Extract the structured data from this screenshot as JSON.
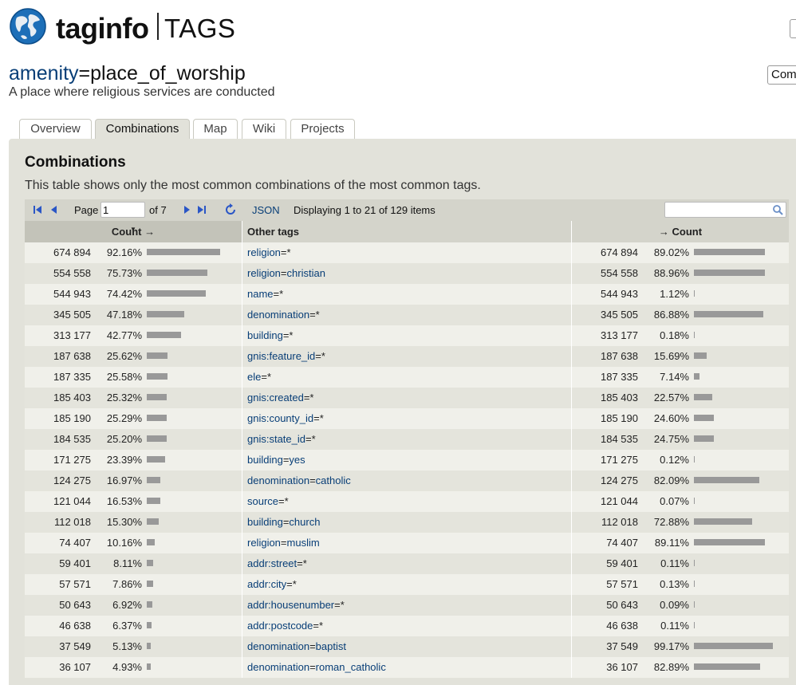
{
  "header": {
    "brand": "taginfo",
    "section": "TAGS",
    "language_label": "Com"
  },
  "tag": {
    "key": "amenity",
    "eq": "=",
    "value": "place_of_worship",
    "description": "A place where religious services are conducted"
  },
  "tabs": [
    {
      "label": "Overview",
      "active": false
    },
    {
      "label": "Combinations",
      "active": true
    },
    {
      "label": "Map",
      "active": false
    },
    {
      "label": "Wiki",
      "active": false
    },
    {
      "label": "Projects",
      "active": false
    }
  ],
  "panel": {
    "title": "Combinations",
    "text": "This table shows only the most common combinations of the most common tags."
  },
  "pager": {
    "page_label": "Page",
    "page_value": "1",
    "of_label": "of 7",
    "json_label": "JSON",
    "display_text": "Displaying 1 to 21 of 129 items",
    "search_placeholder": ""
  },
  "columns": {
    "count_left": "Count →",
    "other_tags": "Other tags",
    "count_right": "→ Count"
  },
  "rows": [
    {
      "count": "674 894",
      "pct": "92.16%",
      "key": "religion",
      "value": "*",
      "count2": "674 894",
      "pct2": "89.02%"
    },
    {
      "count": "554 558",
      "pct": "75.73%",
      "key": "religion",
      "value": "christian",
      "count2": "554 558",
      "pct2": "88.96%"
    },
    {
      "count": "544 943",
      "pct": "74.42%",
      "key": "name",
      "value": "*",
      "count2": "544 943",
      "pct2": "1.12%"
    },
    {
      "count": "345 505",
      "pct": "47.18%",
      "key": "denomination",
      "value": "*",
      "count2": "345 505",
      "pct2": "86.88%"
    },
    {
      "count": "313 177",
      "pct": "42.77%",
      "key": "building",
      "value": "*",
      "count2": "313 177",
      "pct2": "0.18%"
    },
    {
      "count": "187 638",
      "pct": "25.62%",
      "key": "gnis:feature_id",
      "value": "*",
      "count2": "187 638",
      "pct2": "15.69%"
    },
    {
      "count": "187 335",
      "pct": "25.58%",
      "key": "ele",
      "value": "*",
      "count2": "187 335",
      "pct2": "7.14%"
    },
    {
      "count": "185 403",
      "pct": "25.32%",
      "key": "gnis:created",
      "value": "*",
      "count2": "185 403",
      "pct2": "22.57%"
    },
    {
      "count": "185 190",
      "pct": "25.29%",
      "key": "gnis:county_id",
      "value": "*",
      "count2": "185 190",
      "pct2": "24.60%"
    },
    {
      "count": "184 535",
      "pct": "25.20%",
      "key": "gnis:state_id",
      "value": "*",
      "count2": "184 535",
      "pct2": "24.75%"
    },
    {
      "count": "171 275",
      "pct": "23.39%",
      "key": "building",
      "value": "yes",
      "count2": "171 275",
      "pct2": "0.12%"
    },
    {
      "count": "124 275",
      "pct": "16.97%",
      "key": "denomination",
      "value": "catholic",
      "count2": "124 275",
      "pct2": "82.09%"
    },
    {
      "count": "121 044",
      "pct": "16.53%",
      "key": "source",
      "value": "*",
      "count2": "121 044",
      "pct2": "0.07%"
    },
    {
      "count": "112 018",
      "pct": "15.30%",
      "key": "building",
      "value": "church",
      "count2": "112 018",
      "pct2": "72.88%"
    },
    {
      "count": "74 407",
      "pct": "10.16%",
      "key": "religion",
      "value": "muslim",
      "count2": "74 407",
      "pct2": "89.11%"
    },
    {
      "count": "59 401",
      "pct": "8.11%",
      "key": "addr:street",
      "value": "*",
      "count2": "59 401",
      "pct2": "0.11%"
    },
    {
      "count": "57 571",
      "pct": "7.86%",
      "key": "addr:city",
      "value": "*",
      "count2": "57 571",
      "pct2": "0.13%"
    },
    {
      "count": "50 643",
      "pct": "6.92%",
      "key": "addr:housenumber",
      "value": "*",
      "count2": "50 643",
      "pct2": "0.09%"
    },
    {
      "count": "46 638",
      "pct": "6.37%",
      "key": "addr:postcode",
      "value": "*",
      "count2": "46 638",
      "pct2": "0.11%"
    },
    {
      "count": "37 549",
      "pct": "5.13%",
      "key": "denomination",
      "value": "baptist",
      "count2": "37 549",
      "pct2": "99.17%"
    },
    {
      "count": "36 107",
      "pct": "4.93%",
      "key": "denomination",
      "value": "roman_catholic",
      "count2": "36 107",
      "pct2": "82.89%"
    }
  ]
}
